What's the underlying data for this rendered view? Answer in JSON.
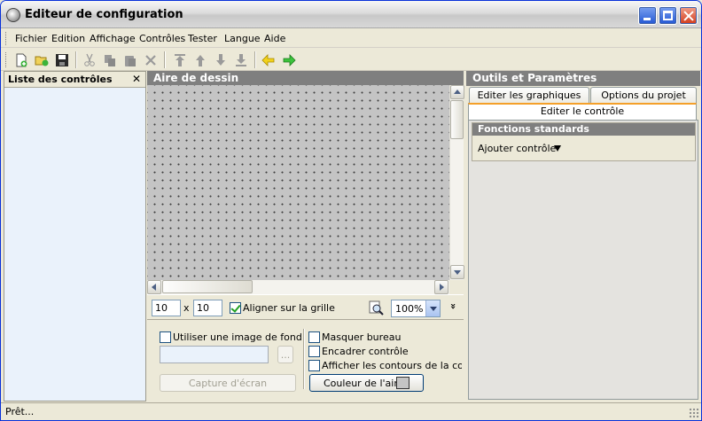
{
  "window": {
    "title": "Editeur de configuration"
  },
  "menu": [
    "Fichier",
    "Edition",
    "Affichage",
    "Contrôles",
    "Tester",
    "Langue",
    "Aide"
  ],
  "toolbar": {
    "icons": [
      "new-file-icon",
      "open-folder-icon",
      "save-icon",
      "cut-icon",
      "copy-icon",
      "paste-icon",
      "delete-icon",
      "move-top-icon",
      "move-up-icon",
      "move-down-icon",
      "move-bottom-icon",
      "arrow-left-icon",
      "arrow-right-icon"
    ]
  },
  "left_panel": {
    "title": "Liste des contrôles",
    "close_glyph": "✕"
  },
  "draw_panel": {
    "title": "Aire de dessin",
    "grid_x": "10",
    "grid_y": "10",
    "times": "x",
    "snap_label": "Aligner sur la grille",
    "snap_checked": true,
    "zoom": "100%",
    "expand_glyph": "»",
    "options": {
      "use_bg_image": "Utiliser une image de fond",
      "browse": "...",
      "capture": "Capture d'écran",
      "hide_desktop": "Masquer bureau",
      "frame_control": "Encadrer contrôle",
      "show_outline": "Afficher les contours de la config",
      "area_color": "Couleur de l'aire"
    }
  },
  "right_panel": {
    "title": "Outils et Paramètres",
    "tabs": [
      "Editer les graphiques",
      "Options du projet",
      "Editer le contrôle"
    ],
    "section_title": "Fonctions standards",
    "section_item": "Ajouter contrôle"
  },
  "status": {
    "text": "Prêt..."
  },
  "colors": {
    "panel_header": "#7f7f7f",
    "canvas": "#c4c4c4",
    "tab_accent": "#f4a02a",
    "xp_blue": "#0831d9"
  }
}
